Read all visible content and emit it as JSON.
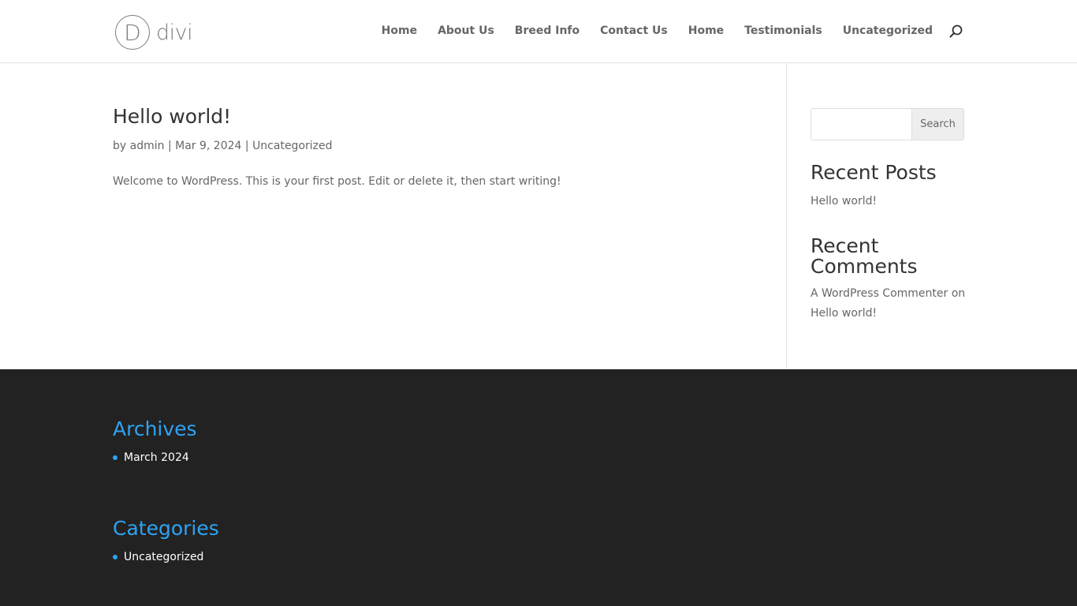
{
  "header": {
    "logo_letter": "D",
    "logo_text": "divi",
    "nav": [
      "Home",
      "About Us",
      "Breed Info",
      "Contact Us",
      "Home",
      "Testimonials",
      "Uncategorized"
    ],
    "search_icon": "search-icon"
  },
  "post": {
    "title": "Hello world!",
    "meta_by": "by",
    "author": "admin",
    "separator": "|",
    "date": "Mar 9, 2024",
    "category": "Uncategorized",
    "excerpt": "Welcome to WordPress. This is your first post. Edit or delete it, then start writing!"
  },
  "sidebar": {
    "search_placeholder": "",
    "search_button": "Search",
    "recent_posts_title": "Recent Posts",
    "recent_posts": [
      "Hello world!"
    ],
    "recent_comments_title": "Recent Comments",
    "comment_author": "A WordPress Commenter",
    "comment_on": "on",
    "comment_post": "Hello world!"
  },
  "footer": {
    "archives_title": "Archives",
    "archives": [
      "March 2024"
    ],
    "categories_title": "Categories",
    "categories": [
      "Uncategorized"
    ]
  },
  "colors": {
    "accent": "#2ea3f2",
    "footer_bg": "#222222",
    "text": "#666666",
    "heading": "#333333"
  }
}
